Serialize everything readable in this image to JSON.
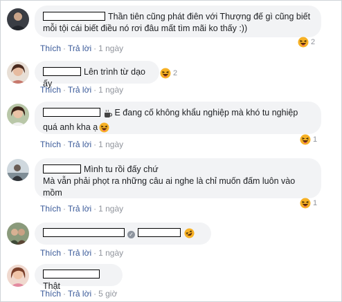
{
  "actions": {
    "like": "Thích",
    "reply": "Trả lời",
    "separator": "·"
  },
  "comments": [
    {
      "text": "Thần tiên cũng phát điên với Thượng đế gì cũng biết mỗi tội cái biết điều nó rơi đâu mất tìm mãi ko thấy :))",
      "time": "1 ngày",
      "reaction_count": "2"
    },
    {
      "text": "Lên trình từ dạo ấy",
      "time": "1 ngày",
      "reaction_count": "2"
    },
    {
      "text": "E đang cố không khẩu nghiệp mà khó tu nghiệp quá anh kha ạ",
      "time": "1 ngày",
      "reaction_count": "1"
    },
    {
      "text": "Mình tu rồi đấy chứ\nMà vẫn phải phọt ra những câu ai nghe là chỉ muốn đấm luôn vào mồm",
      "time": "1 ngày",
      "reaction_count": "1"
    },
    {
      "text": "",
      "time": "1 ngày",
      "reaction_count": ""
    },
    {
      "text": "Thật",
      "time": "5 giờ",
      "reaction_count": ""
    }
  ],
  "icons": {
    "laugh": "laughing-emoji-icon",
    "coffee": "coffee-cup-icon",
    "verified": "verified-badge-icon"
  },
  "colors": {
    "link": "#385898",
    "meta": "#90949c",
    "bubble": "#f2f3f5",
    "emoji": "#f7b125"
  }
}
